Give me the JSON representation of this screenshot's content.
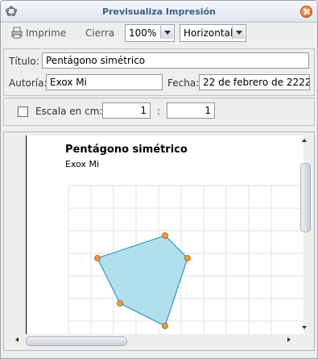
{
  "window": {
    "title": "Previsualiza Impresión"
  },
  "toolbar": {
    "print_label": "Imprime",
    "close_label": "Cierra",
    "zoom_value": "100%",
    "orientation_value": "Horizontal"
  },
  "form": {
    "title_label": "Título:",
    "title_value": "Pentágono simétrico",
    "author_label": "Autoría:",
    "author_value": "Exox Mi",
    "date_label": "Fecha:",
    "date_value": "22 de febrero de 2222"
  },
  "scale": {
    "label": "Escala en cm:",
    "checked": false,
    "left_value": "1",
    "separator": ":",
    "right_value": "1"
  },
  "preview": {
    "doc_title": "Pentágono simétrico",
    "doc_author": "Exox Mi",
    "polygon_fill": "#aadcec",
    "polygon_stroke": "#3b9fc4",
    "point_color": "#f29a3c"
  }
}
